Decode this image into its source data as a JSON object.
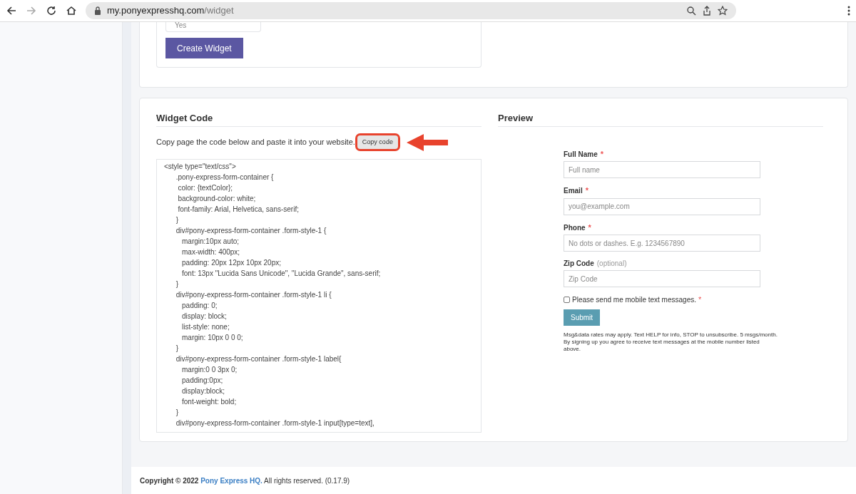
{
  "browser": {
    "url_host": "my.ponyexpresshq.com",
    "url_path": "/widget",
    "forward_disabled": true
  },
  "widget_form": {
    "select_value": "Yes",
    "button": "Create Widget"
  },
  "widget_code": {
    "title": "Widget Code",
    "instructions": "Copy page the code below and paste it into your website.",
    "copy_button": "Copy code",
    "highlighted": true,
    "code": "<style type=\"text/css\">\n      .pony-express-form-container {\n       color: {textColor};\n       background-color: white;\n       font-family: Arial, Helvetica, sans-serif;\n      }\n      div#pony-express-form-container .form-style-1 {\n         margin:10px auto;\n         max-width: 400px;\n         padding: 20px 12px 10px 20px;\n         font: 13px \"Lucida Sans Unicode\", \"Lucida Grande\", sans-serif;\n      }\n      div#pony-express-form-container .form-style-1 li {\n         padding: 0;\n         display: block;\n         list-style: none;\n         margin: 10px 0 0 0;\n      }\n      div#pony-express-form-container .form-style-1 label{\n         margin:0 0 3px 0;\n         padding:0px;\n         display:block;\n         font-weight: bold;\n      }\n      div#pony-express-form-container .form-style-1 input[type=text],"
  },
  "preview": {
    "title": "Preview",
    "fields": [
      {
        "label": "Full Name",
        "required_mark": "*",
        "placeholder": "Full name"
      },
      {
        "label": "Email",
        "required_mark": "*",
        "placeholder": "you@example.com"
      },
      {
        "label": "Phone",
        "required_mark": "*",
        "placeholder": "No dots or dashes. E.g. 1234567890"
      },
      {
        "label": "Zip Code",
        "note": "(optional)",
        "placeholder": "Zip Code"
      }
    ],
    "consent": {
      "label": "Please send me mobile text messages.",
      "checked": false,
      "required_mark": "*"
    },
    "submit": "Submit",
    "disclaimer": "Msg&data rates may apply. Text HELP for info, STOP to unsubscribe. 5 msgs/month. By signing up you agree to receive text messages at the mobile number listed above."
  },
  "footer": {
    "prefix": "Copyright © 2022",
    "link": "Pony Express HQ.",
    "suffix": "All rights reserved. (0.17.9)"
  }
}
